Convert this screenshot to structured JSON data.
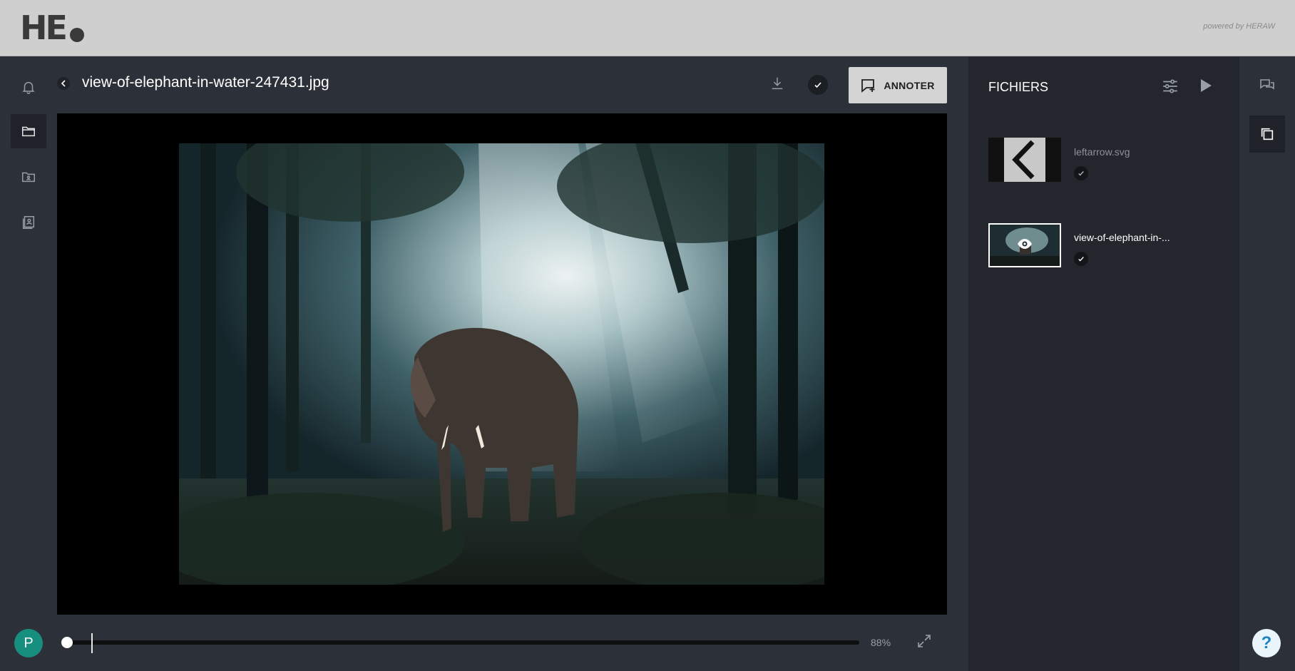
{
  "header": {
    "logo_text": "HE",
    "powered_by": "powered by HERAW"
  },
  "viewer": {
    "file_title": "view-of-elephant-in-water-247431.jpg",
    "annotate_label": "ANNOTER",
    "zoom_label": "88%",
    "timeline_progress": 0
  },
  "left_rail": {
    "items": [
      {
        "icon": "bell-icon",
        "active": false
      },
      {
        "icon": "folder-icon",
        "active": true
      },
      {
        "icon": "shared-folder-icon",
        "active": false
      },
      {
        "icon": "contacts-book-icon",
        "active": false
      }
    ],
    "avatar_initial": "P"
  },
  "files_panel": {
    "title": "FICHIERS",
    "files": [
      {
        "name": "leftarrow.svg",
        "selected": false,
        "validated": true
      },
      {
        "name": "view-of-elephant-in-...",
        "selected": true,
        "validated": true
      }
    ]
  },
  "right_rail": {
    "items": [
      {
        "icon": "comments-icon",
        "active": false
      },
      {
        "icon": "layers-icon",
        "active": true
      }
    ]
  },
  "help": {
    "label": "?"
  },
  "colors": {
    "header_bg": "#cfcfcf",
    "app_bg": "#2c3038",
    "panel_bg": "#23262c",
    "avatar": "#178f7e",
    "help_fg": "#1b85c6"
  }
}
